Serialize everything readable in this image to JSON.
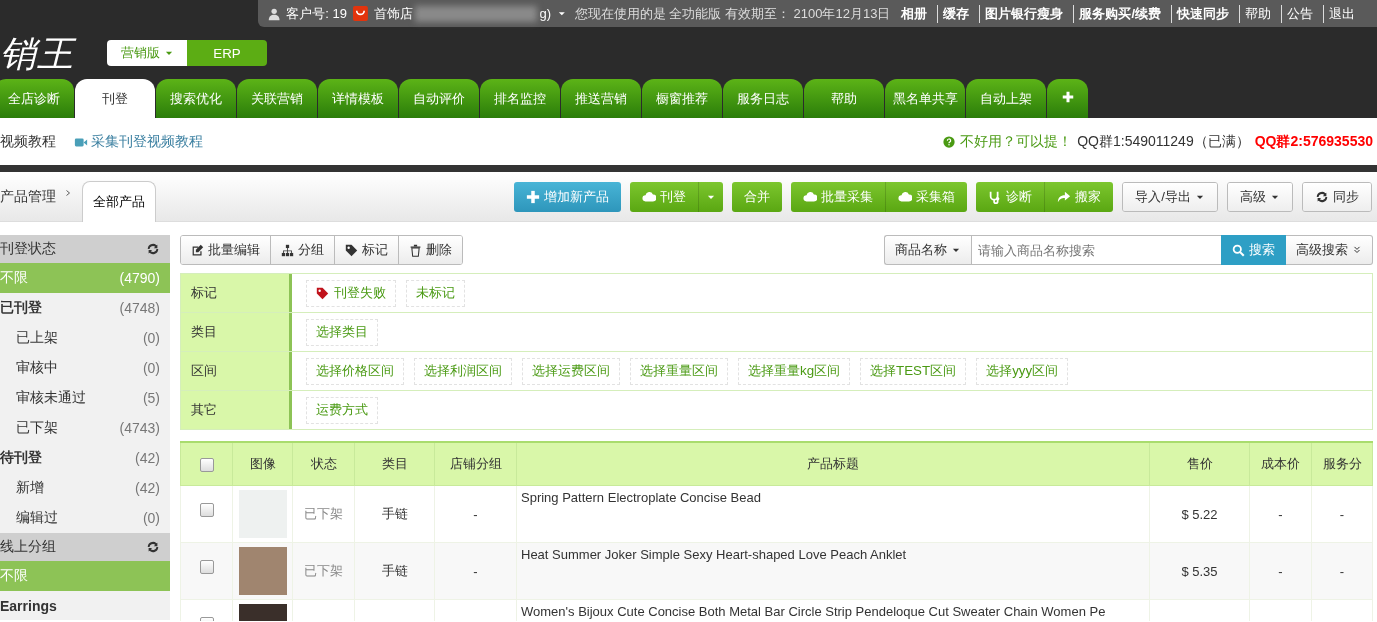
{
  "topbar": {
    "customer": "客户号: 19",
    "store": "首饰店",
    "store_tail": "g)",
    "notice": "您现在使用的是 全功能版 有效期至： 2100年12月13日",
    "links": [
      {
        "label": "相册",
        "strong": true
      },
      {
        "label": "缓存",
        "strong": true
      },
      {
        "label": "图片银行瘦身",
        "strong": true
      },
      {
        "label": "服务购买/续费",
        "strong": true
      },
      {
        "label": "快速同步",
        "strong": true
      },
      {
        "label": "帮助",
        "strong": false
      },
      {
        "label": "公告",
        "strong": false
      },
      {
        "label": "退出",
        "strong": false
      }
    ]
  },
  "header": {
    "logo": "销王",
    "editions": [
      {
        "label": "营销版",
        "selected": true,
        "caret": true
      },
      {
        "label": "ERP",
        "selected": false,
        "caret": false
      }
    ]
  },
  "nav_tabs": [
    {
      "label": "全店诊断",
      "selected": false
    },
    {
      "label": "刊登",
      "selected": true
    },
    {
      "label": "搜索优化",
      "selected": false
    },
    {
      "label": "关联营销",
      "selected": false
    },
    {
      "label": "详情模板",
      "selected": false
    },
    {
      "label": "自动评价",
      "selected": false
    },
    {
      "label": "排名监控",
      "selected": false
    },
    {
      "label": "推送营销",
      "selected": false
    },
    {
      "label": "橱窗推荐",
      "selected": false
    },
    {
      "label": "服务日志",
      "selected": false
    },
    {
      "label": "帮助",
      "selected": false
    },
    {
      "label": "黑名单共享",
      "selected": false
    },
    {
      "label": "自动上架",
      "selected": false
    }
  ],
  "sub_bar": {
    "tutorial_cut": "视频教程",
    "tutorial": "采集刊登视频教程",
    "feedback": "不好用？可以提！",
    "qq1": "QQ群1:549011249（已满）",
    "qq2": "QQ群2:576935530"
  },
  "breadcrumb": {
    "parent": "产品管理",
    "tabs": [
      {
        "label": "全部产品",
        "selected": true
      }
    ]
  },
  "actions": [
    {
      "kind": "blue",
      "buttons": [
        {
          "label": "增加新产品"
        }
      ],
      "caret": false
    },
    {
      "kind": "green",
      "buttons": [
        {
          "label": "刊登"
        }
      ],
      "caret": true
    },
    {
      "kind": "green",
      "buttons": [
        {
          "label": "合并"
        }
      ],
      "caret": false
    },
    {
      "kind": "green",
      "buttons": [
        {
          "label": "批量采集"
        },
        {
          "label": "采集箱"
        }
      ],
      "caret": false
    },
    {
      "kind": "green",
      "buttons": [
        {
          "label": "诊断"
        },
        {
          "label": "搬家"
        }
      ],
      "caret": false
    },
    {
      "kind": "light",
      "buttons": [
        {
          "label": "导入/导出"
        }
      ],
      "caret": true
    },
    {
      "kind": "light",
      "buttons": [
        {
          "label": "高级"
        }
      ],
      "caret": true
    },
    {
      "kind": "light",
      "buttons": [
        {
          "label": "同步"
        }
      ],
      "caret": false
    }
  ],
  "sidebar": [
    {
      "title": "刊登状态",
      "items": [
        {
          "label": "不限",
          "count": "(4790)",
          "selected": true
        },
        {
          "label": "已刊登",
          "count": "(4748)",
          "selected": false,
          "children": [
            {
              "label": "已上架",
              "count": "(0)",
              "selected": false
            },
            {
              "label": "审核中",
              "count": "(0)",
              "selected": false
            },
            {
              "label": "审核未通过",
              "count": "(5)",
              "selected": false
            },
            {
              "label": "已下架",
              "count": "(4743)",
              "selected": false
            }
          ]
        },
        {
          "label": "待刊登",
          "count": "(42)",
          "selected": false,
          "children": [
            {
              "label": "新增",
              "count": "(42)",
              "selected": false
            },
            {
              "label": "编辑过",
              "count": "(0)",
              "selected": false
            }
          ]
        }
      ]
    },
    {
      "title": "线上分组",
      "items": [
        {
          "label": "不限",
          "selected": true
        },
        {
          "label": "Earrings",
          "selected": false
        }
      ]
    }
  ],
  "batch_tools": [
    {
      "label": "批量编辑"
    },
    {
      "label": "分组"
    },
    {
      "label": "标记"
    },
    {
      "label": "删除"
    }
  ],
  "search": {
    "field": "商品名称",
    "placeholder": "请输入商品名称搜索",
    "button": "搜索",
    "advanced": "高级搜索"
  },
  "filters": [
    {
      "label": "标记",
      "options": [
        {
          "label": "刊登失败",
          "kind": "tag"
        },
        {
          "label": "未标记",
          "kind": "plain"
        }
      ]
    },
    {
      "label": "类目",
      "options": [
        {
          "label": "选择类目",
          "kind": "plain"
        }
      ]
    },
    {
      "label": "区间",
      "options": [
        {
          "label": "选择价格区间",
          "kind": "plain"
        },
        {
          "label": "选择利润区间",
          "kind": "plain"
        },
        {
          "label": "选择运费区间",
          "kind": "plain"
        },
        {
          "label": "选择重量区间",
          "kind": "plain"
        },
        {
          "label": "选择重量kg区间",
          "kind": "plain"
        },
        {
          "label": "选择TEST区间",
          "kind": "plain"
        },
        {
          "label": "选择yyy区间",
          "kind": "plain"
        }
      ]
    },
    {
      "label": "其它",
      "options": [
        {
          "label": "运费方式",
          "kind": "plain"
        }
      ]
    }
  ],
  "table": {
    "all_selected": false,
    "columns": [
      "图像",
      "状态",
      "类目",
      "店铺分组",
      "产品标题",
      "售价",
      "成本价",
      "服务分"
    ],
    "rows": [
      {
        "selected": false,
        "status": "已下架",
        "category": "手链",
        "group": "-",
        "title": "Spring Pattern Electroplate Concise Bead",
        "price": "$ 5.22",
        "cost": "-",
        "score": "-"
      },
      {
        "selected": false,
        "status": "已下架",
        "category": "手链",
        "group": "-",
        "title": "Heat Summer Joker Simple Sexy Heart-shaped Love Peach Anklet",
        "price": "$ 5.35",
        "cost": "-",
        "score": "-"
      },
      {
        "selected": false,
        "title": "Women's Bijoux Cute Concise Both Metal Bar Circle Strip Pendeloque Cut Sweater Chain Women Pe"
      }
    ]
  }
}
